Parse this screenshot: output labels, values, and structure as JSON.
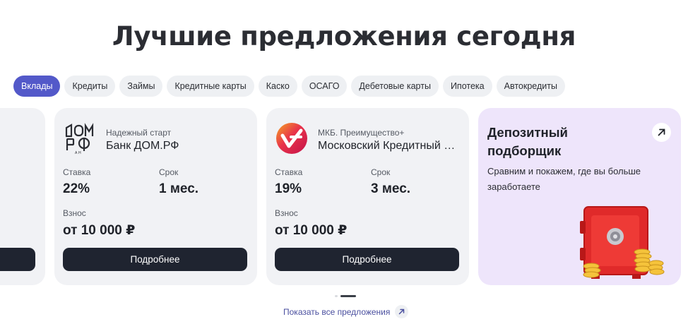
{
  "page_title": "Лучшие предложения сегодня",
  "tabs": [
    {
      "label": "Вклады",
      "active": true
    },
    {
      "label": "Кредиты",
      "active": false
    },
    {
      "label": "Займы",
      "active": false
    },
    {
      "label": "Кредитные карты",
      "active": false
    },
    {
      "label": "Каско",
      "active": false
    },
    {
      "label": "ОСАГО",
      "active": false
    },
    {
      "label": "Дебетовые карты",
      "active": false
    },
    {
      "label": "Ипотека",
      "active": false
    },
    {
      "label": "Автокредиты",
      "active": false
    }
  ],
  "offers": [
    {
      "product": "Надежный старт",
      "bank": "Банк ДОМ.РФ",
      "logo_text": "ДОМ.РФ",
      "rate_label": "Ставка",
      "rate": "22%",
      "term_label": "Срок",
      "term": "1 мес.",
      "deposit_label": "Взнос",
      "deposit": "от 10 000 ₽",
      "button": "Подробнее",
      "logo_icon": "dom-rf-logo-icon"
    },
    {
      "product": "МКБ. Преимущество+",
      "bank": "Московский Кредитный Банк",
      "rate_label": "Ставка",
      "rate": "19%",
      "term_label": "Срок",
      "term": "3 мес.",
      "deposit_label": "Взнос",
      "deposit": "от 10 000 ₽",
      "button": "Подробнее",
      "logo_icon": "mkb-logo-icon"
    }
  ],
  "promo": {
    "title": "Депозитный подборщик",
    "text": "Сравним и покажем, где вы больше заработаете",
    "arrow_icon": "arrow-up-right-icon",
    "image_icon": "safe-with-coins-icon"
  },
  "carousel": {
    "pages": 2,
    "current": 2
  },
  "show_all": {
    "label": "Показать все предложения",
    "icon": "arrow-up-right-icon"
  },
  "colors": {
    "accent": "#5359c9",
    "button": "#1f2430",
    "card_bg": "#f1f2f5",
    "promo_bg": "#eee5fb",
    "link": "#4a4f9f"
  }
}
